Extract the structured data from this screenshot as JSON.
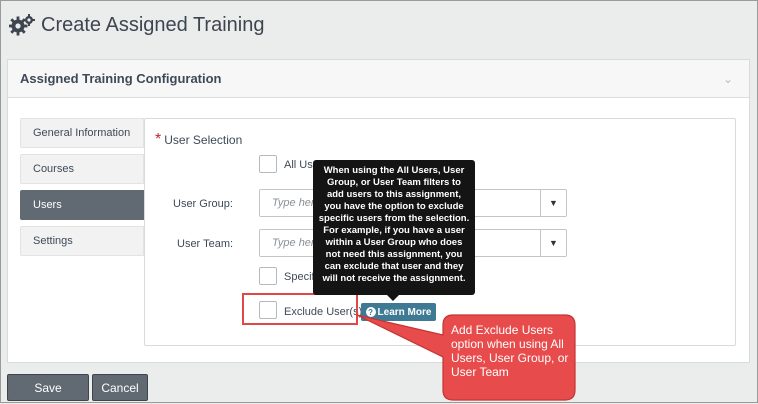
{
  "page": {
    "title": "Create Assigned Training"
  },
  "card": {
    "title": "Assigned Training Configuration"
  },
  "nav": {
    "items": [
      {
        "label": "General Information"
      },
      {
        "label": "Courses"
      },
      {
        "label": "Users"
      },
      {
        "label": "Settings"
      }
    ]
  },
  "users": {
    "section_title": "User Selection",
    "all_users_label": "All Users",
    "user_group_label": "User Group:",
    "user_group_placeholder": "Type here",
    "user_team_label": "User Team:",
    "user_team_placeholder": "Type here",
    "specific_label": "Specific",
    "exclude_label": "Exclude User(s)",
    "learn_more_label": "Learn More"
  },
  "tooltip": {
    "text": "When using the All Users, User Group, or User Team filters to add users to this assignment, you have the option to exclude specific users from the selection. For example, if you have a user within a User Group who does not need this assignment, you can exclude that user and they will not receive the assignment."
  },
  "callout": {
    "text": "Add Exclude Users option when using All Users, User Group, or User Team"
  },
  "footer": {
    "save_label": "Save",
    "cancel_label": "Cancel"
  },
  "colors": {
    "accent": "#616a72",
    "learn_more": "#3f7a95",
    "callout_fill": "#e84b4b",
    "required": "#c0272d"
  },
  "icons": {
    "page": "gears-icon",
    "collapse": "chevron-down-icon",
    "dropdown": "caret-down-icon",
    "help": "question-circle-icon"
  }
}
